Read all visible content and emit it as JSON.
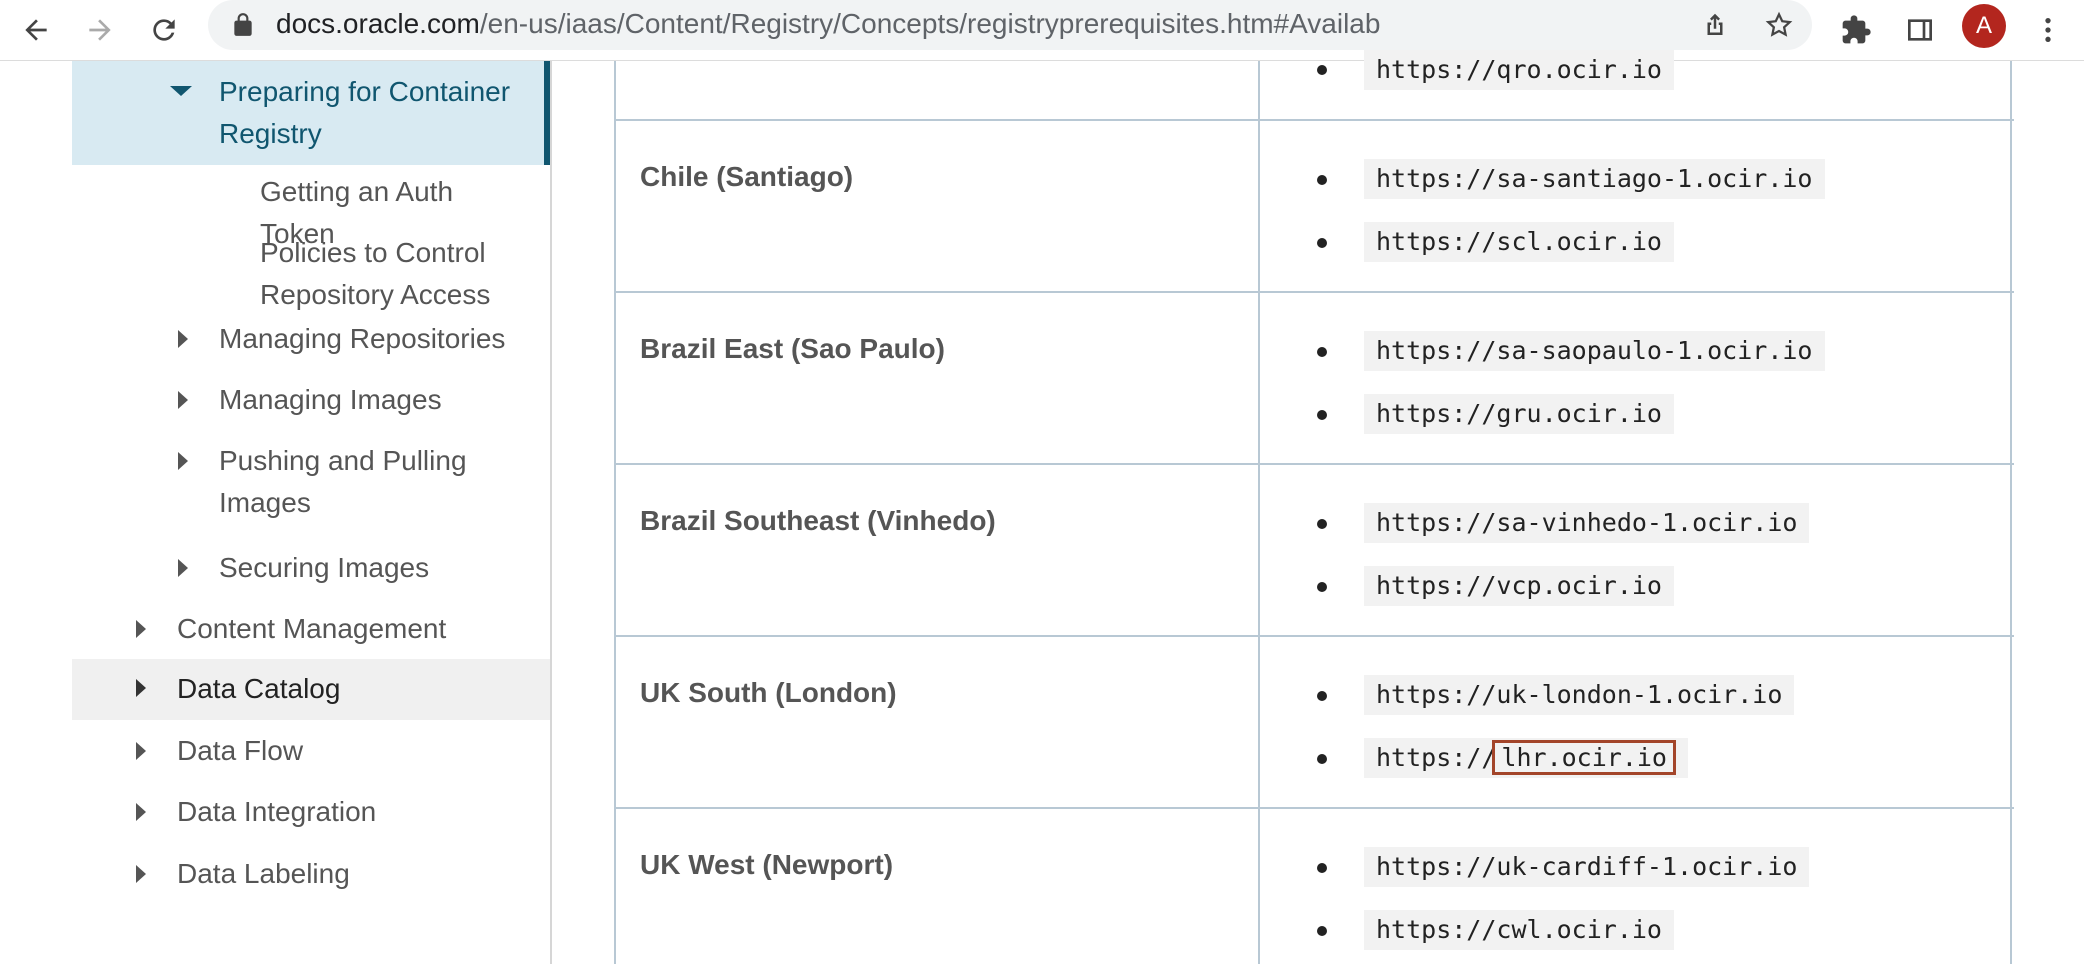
{
  "browser": {
    "url_host": "docs.oracle.com",
    "url_path": "/en-us/iaas/Content/Registry/Concepts/registryprerequisites.htm#Availab",
    "avatar_letter": "A",
    "icons": [
      "back-icon",
      "forward-icon",
      "reload-icon",
      "lock-icon",
      "share-icon",
      "star-icon",
      "extensions-icon",
      "side-panel-icon",
      "more-icon"
    ]
  },
  "sidebar": {
    "items": [
      {
        "label": "Preparing for Container Registry",
        "state": "active",
        "caret": "down"
      },
      {
        "label": "Getting an Auth Token",
        "caret": "none"
      },
      {
        "label": "Policies to Control Repository Access",
        "caret": "none"
      },
      {
        "label": "Managing Repositories",
        "caret": "right"
      },
      {
        "label": "Managing Images",
        "caret": "right"
      },
      {
        "label": "Pushing and Pulling Images",
        "caret": "right"
      },
      {
        "label": "Securing Images",
        "caret": "right"
      },
      {
        "label": "Content Management",
        "caret": "right"
      },
      {
        "label": "Data Catalog",
        "state": "hover",
        "caret": "right"
      },
      {
        "label": "Data Flow",
        "caret": "right"
      },
      {
        "label": "Data Integration",
        "caret": "right"
      },
      {
        "label": "Data Labeling",
        "caret": "right"
      }
    ]
  },
  "table": {
    "rows": [
      {
        "region": "",
        "endpoints": [
          "https://qro.ocir.io"
        ]
      },
      {
        "region": "Chile (Santiago)",
        "endpoints": [
          "https://sa-santiago-1.ocir.io",
          "https://scl.ocir.io"
        ]
      },
      {
        "region": "Brazil East (Sao Paulo)",
        "endpoints": [
          "https://sa-saopaulo-1.ocir.io",
          "https://gru.ocir.io"
        ]
      },
      {
        "region": "Brazil Southeast (Vinhedo)",
        "endpoints": [
          "https://sa-vinhedo-1.ocir.io",
          "https://vcp.ocir.io"
        ]
      },
      {
        "region": "UK South (London)",
        "endpoints": [
          "https://uk-london-1.ocir.io",
          "https://lhr.ocir.io"
        ],
        "highlight": {
          "prefix": "https://",
          "boxed": "lhr.ocir.io"
        }
      },
      {
        "region": "UK West (Newport)",
        "endpoints": [
          "https://uk-cardiff-1.ocir.io",
          "https://cwl.ocir.io"
        ]
      }
    ]
  },
  "colors": {
    "active_nav_bg": "#d8eaf2",
    "active_nav_text": "#10566f",
    "highlight_box": "#a3452a",
    "avatar_bg": "#b3261e"
  }
}
